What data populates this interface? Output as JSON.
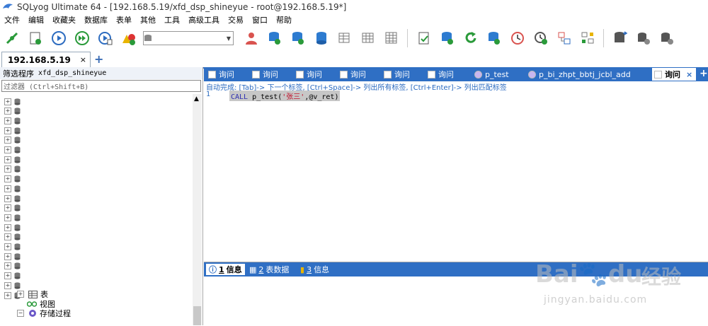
{
  "window": {
    "title": "SQLyog Ultimate 64 - [192.168.5.19/xfd_dsp_shineyue - root@192.168.5.19*]"
  },
  "menu": [
    "文件",
    "编辑",
    "收藏夹",
    "数据库",
    "表单",
    "其他",
    "工具",
    "高级工具",
    "交易",
    "窗口",
    "帮助"
  ],
  "toolbar": {
    "db_select_value": ""
  },
  "connection_tab": {
    "label": "192.168.5.19",
    "close": "×",
    "add": "+"
  },
  "left_panel": {
    "filter_label": "筛选程序",
    "filter_db": "xfd_dsp_shineyue",
    "filter_placeholder": "过滤器 (Ctrl+Shift+B)",
    "expanded": {
      "table": "表",
      "view": "视图",
      "procedure": "存储过程"
    }
  },
  "query_tabs": [
    {
      "label": "询问"
    },
    {
      "label": "询问"
    },
    {
      "label": "询问"
    },
    {
      "label": "询问"
    },
    {
      "label": "询问"
    },
    {
      "label": "询问"
    },
    {
      "label": "p_test"
    },
    {
      "label": "p_bi_zhpt_bbtj_jcbl_add"
    },
    {
      "label": "询问",
      "active": true
    }
  ],
  "editor": {
    "autocomplete_hint": "自动完成: [Tab]-> 下一个标签, [Ctrl+Space]-> 列出所有标签, [Ctrl+Enter]-> 列出匹配标签",
    "line_number": "1",
    "code_keyword": "CALL",
    "code_proc": " p_test(",
    "code_string": "'张三'",
    "code_rest": ",@v_ret)"
  },
  "result_tabs": [
    {
      "num": "1",
      "label": "信息",
      "active": true
    },
    {
      "num": "2",
      "label": "表数据"
    },
    {
      "num": "3",
      "label": "信息"
    }
  ],
  "watermark": {
    "brand": "Bai",
    "brand2": "du",
    "cn": "经验",
    "url": "jingyan.baidu.com"
  },
  "colors": {
    "accent": "#2f6fc4",
    "keyword": "#2d2db0",
    "string": "#c0102a"
  }
}
